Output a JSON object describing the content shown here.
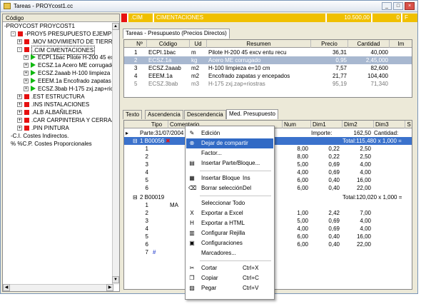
{
  "window": {
    "title": "Tareas - PROYcost1.cc",
    "buttons": [
      "_",
      "□",
      "×"
    ]
  },
  "left": {
    "header": "Código",
    "tree": [
      {
        "indent": 0,
        "exp": "",
        "icon": "",
        "text": "-PROYCOST  PROYCOST1"
      },
      {
        "indent": 1,
        "exp": "-",
        "icon": "red",
        "text": "-PROY5  PRESUPUESTO EJEMPLO"
      },
      {
        "indent": 2,
        "exp": "+",
        "icon": "red",
        "text": ".MOV  MOVIMIENTO DE TIERRAS"
      },
      {
        "indent": 2,
        "exp": "-",
        "icon": "red",
        "text": ".CIM  CIMENTACIONES",
        "sel": true
      },
      {
        "indent": 3,
        "exp": "+",
        "icon": "green",
        "text": "ECPI.1bac  Pilote H-200 45 excv"
      },
      {
        "indent": 3,
        "exp": "+",
        "icon": "green",
        "text": "ECSZ.1a  Acero ME corrugado"
      },
      {
        "indent": 3,
        "exp": "+",
        "icon": "green",
        "text": "ECSZ.2aaab  H-100 limpieza"
      },
      {
        "indent": 3,
        "exp": "+",
        "icon": "green",
        "text": "EEEM.1a  Encofrado zapatas"
      },
      {
        "indent": 3,
        "exp": "+",
        "icon": "green",
        "text": "ECSZ.3bab  H-175 zxj.zap+riostr"
      },
      {
        "indent": 2,
        "exp": "+",
        "icon": "red",
        "text": ".EST  ESTRUCTURA"
      },
      {
        "indent": 2,
        "exp": "+",
        "icon": "red",
        "text": ".INS  INSTALACIONES"
      },
      {
        "indent": 2,
        "exp": "+",
        "icon": "red",
        "text": ".ALB  ALBAÑILERIA"
      },
      {
        "indent": 2,
        "exp": "+",
        "icon": "red",
        "text": ".CAR  CARPINTERIA Y CERRAJERIA"
      },
      {
        "indent": 2,
        "exp": "+",
        "icon": "red",
        "text": ".PIN  PINTURA"
      },
      {
        "indent": 1,
        "exp": "",
        "icon": "",
        "text": "-C.I.  Costes Indirectos."
      },
      {
        "indent": 1,
        "exp": "",
        "icon": "",
        "text": "% %C.P.  Costes Proporcionales"
      }
    ]
  },
  "topstrip": {
    "code": ".CIM",
    "name": "CIMENTACIONES",
    "amount": "10.500,00",
    "extra": "0",
    "flag": "F",
    "accent": "#e81010",
    "band": "#f0c000"
  },
  "tabs_top": {
    "active": "Tareas - Presupuesto (Precios Directos)"
  },
  "grid1": {
    "headers": [
      "Nº",
      "Código",
      "Ud",
      "Resumen",
      "Precio",
      "Cantidad",
      "Im"
    ],
    "rows": [
      {
        "n": "1",
        "code": "ECPI.1bac",
        "ud": "m",
        "res": "Pilote H-200 45 excv entu recu",
        "precio": "36,31",
        "cant": "40,000"
      },
      {
        "n": "2",
        "code": "ECSZ.1a",
        "ud": "kg",
        "res": "Acero ME corrugado",
        "precio": "0,95",
        "cant": "2,45,000",
        "sel": true
      },
      {
        "n": "3",
        "code": "ECSZ.2aaab",
        "ud": "m2",
        "res": "H-100 limpieza e=10 cm",
        "precio": "7,57",
        "cant": "82,600"
      },
      {
        "n": "4",
        "code": "EEEM.1a",
        "ud": "m2",
        "res": "Encofrado zapatas y encepados",
        "precio": "21,77",
        "cant": "104,400"
      },
      {
        "n": "5",
        "code": "ECSZ.3bab",
        "ud": "m3",
        "res": "H-175 zxj.zap+riostras",
        "precio": "95,19",
        "cant": "71,340",
        "grey": true
      }
    ]
  },
  "tabs_bottom": [
    "Texto",
    "Ascendencia",
    "Descendencia",
    "Med. Presupuesto"
  ],
  "tabs_bottom_active": "Med. Presupuesto",
  "grid2": {
    "headers": [
      "Tipo",
      "Comentario",
      "Num",
      "Dim1",
      "Dim2",
      "Dim3",
      "S"
    ],
    "parte": {
      "label": "Parte:31/07/2004",
      "importe_label": "Importe:",
      "importe": "162,50",
      "cantidad_label": "Cantidad:"
    },
    "group1": {
      "code": "1 B00056",
      "total": "Total:115,480 x 1,000  ="
    },
    "rows1": [
      {
        "n": "1",
        "num": "8,00",
        "d1": "0,22",
        "d2": "2,50"
      },
      {
        "n": "2",
        "num": "8,00",
        "d1": "0,22",
        "d2": "2,50"
      },
      {
        "n": "3",
        "num": "5,00",
        "d1": "0,69",
        "d2": "4,00"
      },
      {
        "n": "4",
        "num": "4,00",
        "d1": "0,69",
        "d2": "4,00"
      },
      {
        "n": "5",
        "num": "6,00",
        "d1": "0,40",
        "d2": "16,00"
      },
      {
        "n": "6",
        "num": "6,00",
        "d1": "0,40",
        "d2": "22,00"
      }
    ],
    "group2": {
      "code": "2 B00019",
      "total": "Total:120,020 x 1,000  ="
    },
    "rows2": [
      {
        "n": "1",
        "tipo": "",
        "com": "MA",
        "num": "",
        "d1": "",
        "d2": ""
      },
      {
        "n": "2",
        "num": "1,00",
        "d1": "2,42",
        "d2": "7,00"
      },
      {
        "n": "3",
        "num": "5,00",
        "d1": "0,69",
        "d2": "4,00"
      },
      {
        "n": "4",
        "num": "4,00",
        "d1": "0,69",
        "d2": "4,00"
      },
      {
        "n": "5",
        "num": "6,00",
        "d1": "0,40",
        "d2": "16,00"
      },
      {
        "n": "6",
        "num": "6,00",
        "d1": "0,40",
        "d2": "22,00"
      },
      {
        "n": "7",
        "tipo": "#",
        "num": "",
        "d1": "",
        "d2": ""
      }
    ]
  },
  "menu": {
    "items": [
      {
        "icon": "edit-icon",
        "glyph": "✎",
        "label": "Edición",
        "shortcut": ""
      },
      {
        "icon": "unshare-icon",
        "glyph": "⊗",
        "label": "Dejar de compartir",
        "shortcut": "",
        "hl": true
      },
      {
        "icon": "",
        "glyph": "",
        "label": "Factor...",
        "shortcut": ""
      },
      {
        "icon": "insert-part-icon",
        "glyph": "▤",
        "label": "Insertar Parte/Bloque...",
        "shortcut": ""
      },
      {
        "sep": true
      },
      {
        "icon": "insert-block-icon",
        "glyph": "▦",
        "label": "Insertar Bloque",
        "shortcut": "Ins"
      },
      {
        "icon": "eraser-icon",
        "glyph": "⌫",
        "label": "Borrar selección",
        "shortcut": "Del"
      },
      {
        "sep": true
      },
      {
        "icon": "",
        "glyph": "",
        "label": "Seleccionar Todo",
        "shortcut": ""
      },
      {
        "icon": "excel-icon",
        "glyph": "X",
        "label": "Exportar a Excel",
        "shortcut": ""
      },
      {
        "icon": "html-icon",
        "glyph": "H",
        "label": "Exportar a HTML",
        "shortcut": ""
      },
      {
        "icon": "grid-config-icon",
        "glyph": "▥",
        "label": "Configurar Rejilla",
        "shortcut": ""
      },
      {
        "icon": "config-icon",
        "glyph": "▣",
        "label": "Configuraciones",
        "shortcut": ""
      },
      {
        "icon": "",
        "glyph": "",
        "label": "Marcadores...",
        "shortcut": ""
      },
      {
        "sep": true
      },
      {
        "icon": "cut-icon",
        "glyph": "✂",
        "label": "Cortar",
        "shortcut": "Ctrl+X"
      },
      {
        "icon": "copy-icon",
        "glyph": "❐",
        "label": "Copiar",
        "shortcut": "Ctrl+C"
      },
      {
        "icon": "paste-icon",
        "glyph": "▨",
        "label": "Pegar",
        "shortcut": "Ctrl+V"
      }
    ]
  }
}
